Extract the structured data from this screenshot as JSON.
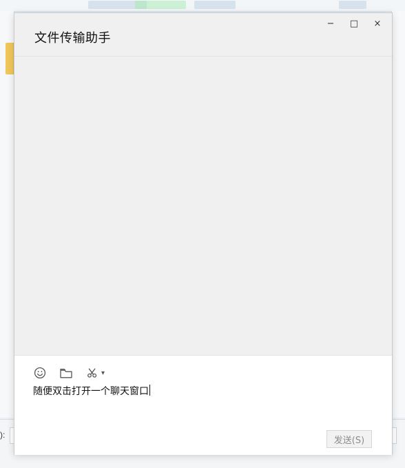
{
  "background": {
    "bottom_label": "):"
  },
  "window": {
    "title": "文件传输助手",
    "controls": {
      "minimize": "−",
      "maximize": "□",
      "close": "×"
    }
  },
  "composer": {
    "toolbar": {
      "emoji_icon": "emoji-icon",
      "folder_icon": "folder-icon",
      "screenshot_icon": "scissors-icon",
      "dropdown_caret": "▾"
    },
    "message_text": "随便双击打开一个聊天窗口",
    "send_label": "发送(S)"
  }
}
